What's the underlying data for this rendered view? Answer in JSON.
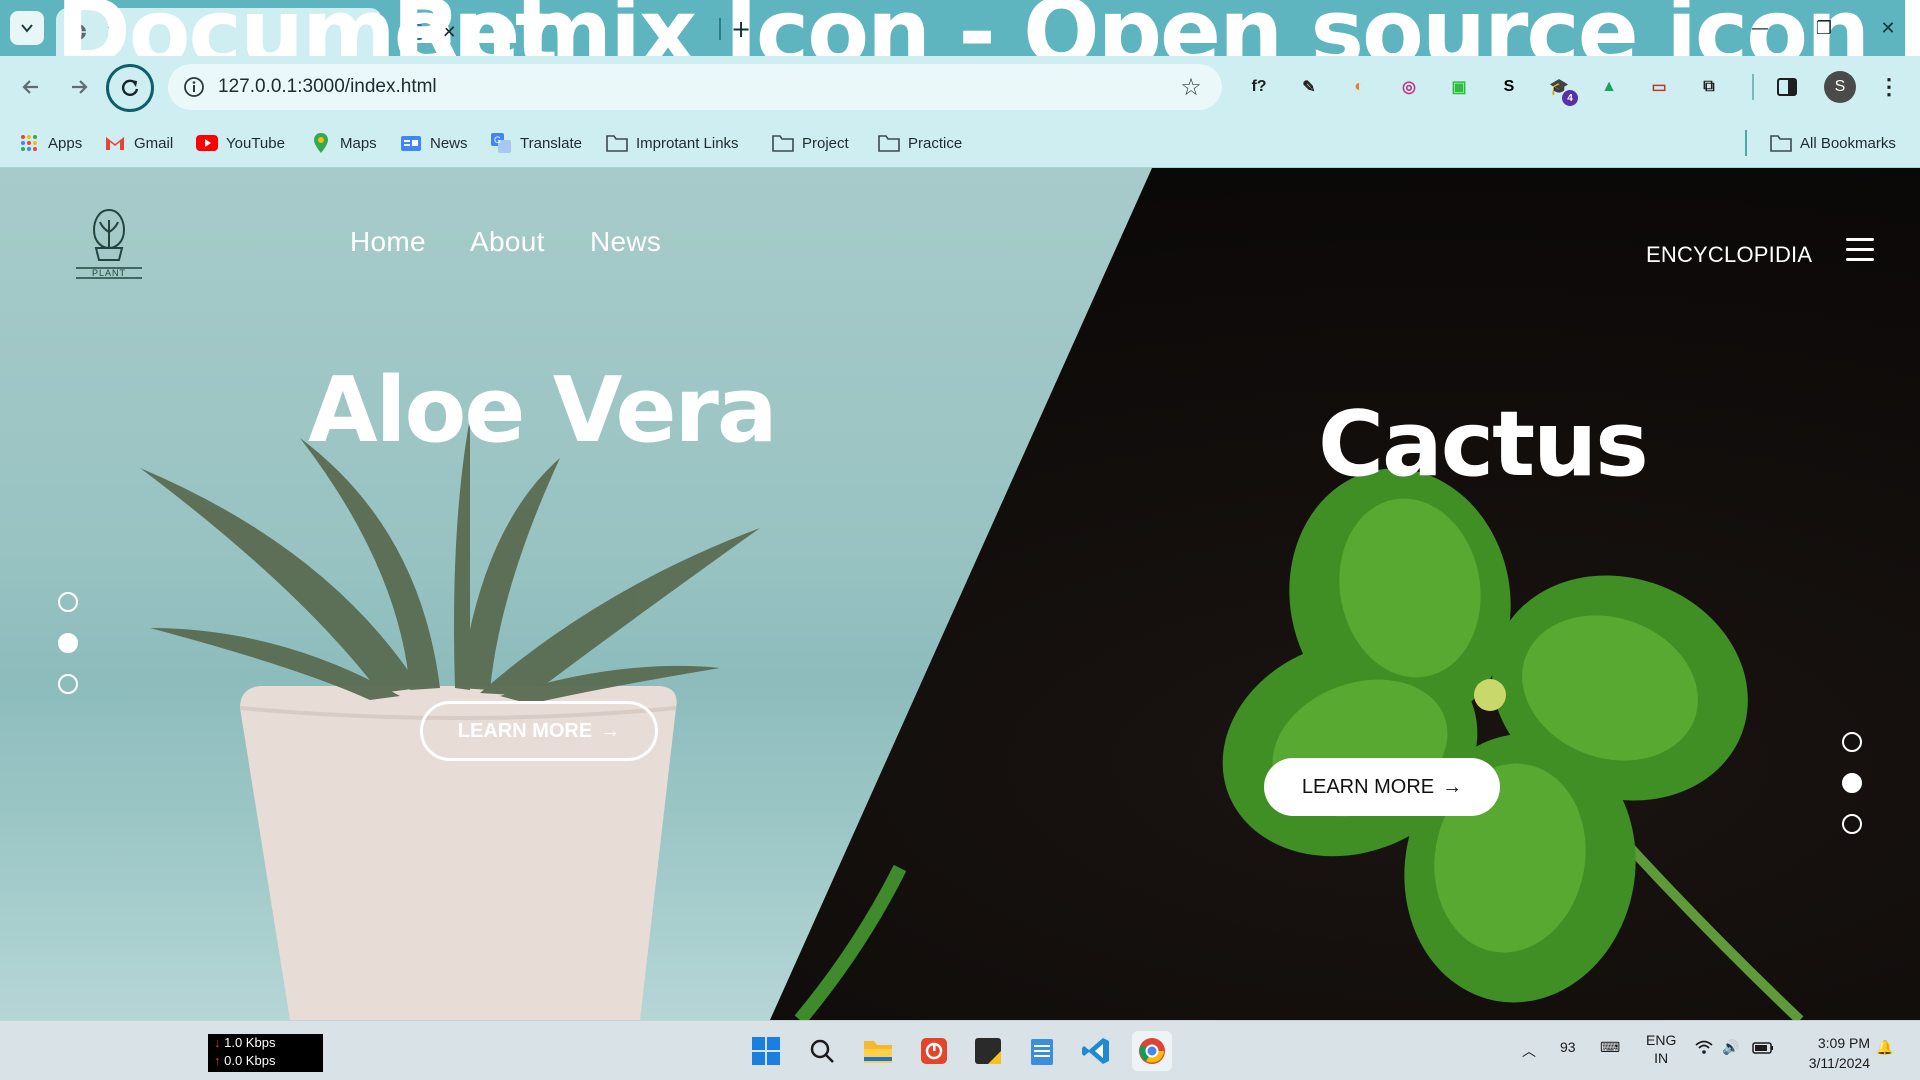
{
  "browser": {
    "tabs": [
      {
        "title": "Document",
        "active": true
      },
      {
        "title": "Remix Icon - Open source icon libr",
        "active": false
      }
    ],
    "new_tab": "+",
    "window_controls": {
      "minimize": "—",
      "restore": "❐",
      "close": "✕"
    },
    "url": "127.0.0.1:3000/index.html",
    "profile_initial": "S",
    "extensions": [
      {
        "name": "formula-extension-icon",
        "glyph": "f?",
        "color": "#1f1f1f"
      },
      {
        "name": "eyedropper-extension-icon",
        "glyph": "✎",
        "color": "#1f1f1f"
      },
      {
        "name": "colorful-extension-icon",
        "glyph": "◐",
        "color": "#f07c1f"
      },
      {
        "name": "instagram-extension-icon",
        "glyph": "◎",
        "color": "#c13584"
      },
      {
        "name": "green-extension-icon",
        "glyph": "▣",
        "color": "#2bbf3a"
      },
      {
        "name": "s-extension-icon",
        "glyph": "S",
        "color": "#000000"
      },
      {
        "name": "graduation-extension-icon",
        "glyph": "🎓",
        "color": "#5a2fa8",
        "badge": "4"
      },
      {
        "name": "drive-extension-icon",
        "glyph": "▲",
        "color": "#1aa260"
      },
      {
        "name": "screen-extension-icon",
        "glyph": "▭",
        "color": "#c0392b"
      },
      {
        "name": "puzzle-extensions-icon",
        "glyph": "⧉",
        "color": "#1f1f1f"
      }
    ],
    "bookmarks": [
      {
        "label": "Apps",
        "icon": "apps-grid-icon"
      },
      {
        "label": "Gmail",
        "icon": "gmail-icon"
      },
      {
        "label": "YouTube",
        "icon": "youtube-icon"
      },
      {
        "label": "Maps",
        "icon": "maps-icon"
      },
      {
        "label": "News",
        "icon": "news-icon"
      },
      {
        "label": "Translate",
        "icon": "translate-icon"
      },
      {
        "label": "Improtant Links",
        "icon": "folder-icon"
      },
      {
        "label": "Project",
        "icon": "folder-icon"
      },
      {
        "label": "Practice",
        "icon": "folder-icon"
      }
    ],
    "all_bookmarks": "All Bookmarks"
  },
  "page": {
    "logo_text": "PLANT",
    "nav": [
      "Home",
      "About",
      "News"
    ],
    "encyclopedia": "ENCYCLOPIDIA",
    "left": {
      "title": "Aloe Vera",
      "button": "LEARN MORE",
      "arrow": "→"
    },
    "right": {
      "title": "Cactus",
      "button": "LEARN MORE",
      "arrow": "→"
    },
    "slider_left": {
      "count": 3,
      "active_index": 1
    },
    "slider_right": {
      "count": 3,
      "active_index": 1
    },
    "colors": {
      "sage": "#9fc8c8",
      "dark": "#0d0a09",
      "white": "#ffffff"
    }
  },
  "taskbar": {
    "net_down": "1.0 Kbps",
    "net_up": "0.0 Kbps",
    "tray_number": "93",
    "language": "ENG",
    "region": "IN",
    "time": "3:09 PM",
    "date": "3/11/2024"
  }
}
